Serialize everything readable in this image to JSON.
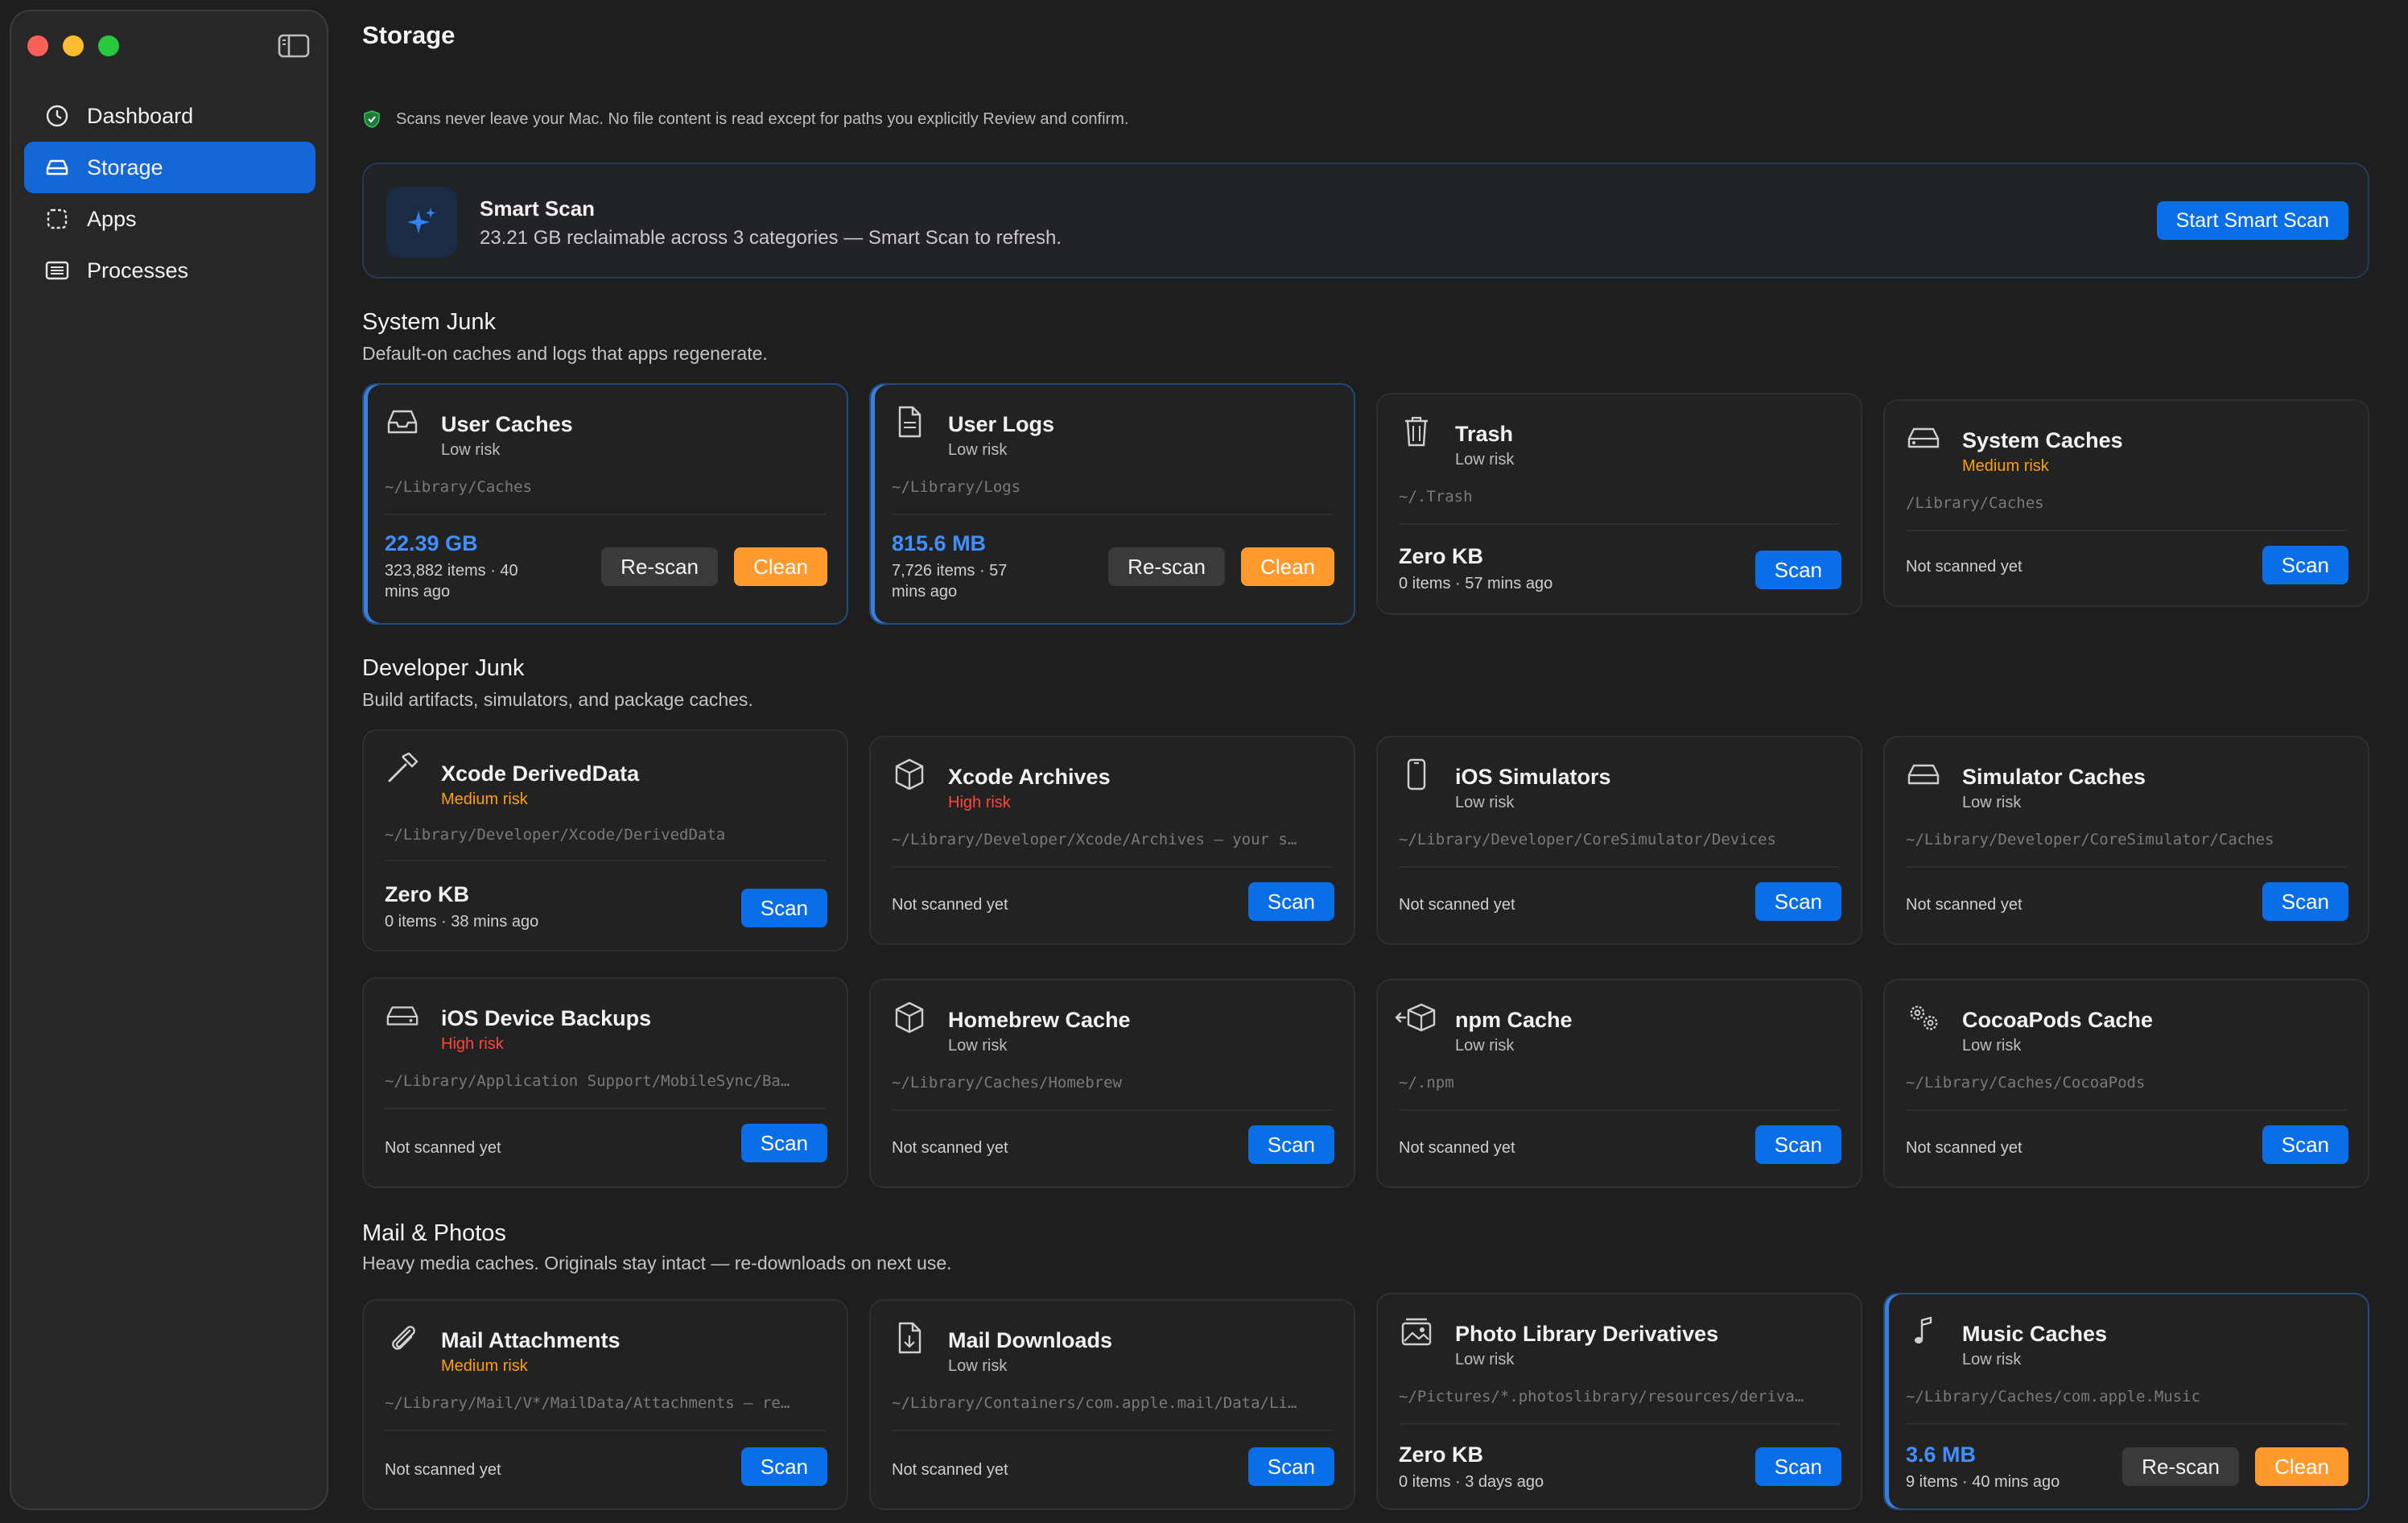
{
  "sidebar": {
    "items": [
      {
        "label": "Dashboard",
        "icon": "gauge-icon"
      },
      {
        "label": "Storage",
        "icon": "drive-icon",
        "active": true
      },
      {
        "label": "Apps",
        "icon": "app-square-icon"
      },
      {
        "label": "Processes",
        "icon": "list-window-icon"
      }
    ]
  },
  "page": {
    "title": "Storage",
    "privacy_note": "Scans never leave your Mac. No file content is read except for paths you explicitly Review and confirm."
  },
  "smart_scan": {
    "title": "Smart Scan",
    "subtitle": "23.21 GB reclaimable across 3 categories — Smart Scan to refresh.",
    "button": "Start Smart Scan"
  },
  "buttons": {
    "scan": "Scan",
    "rescan": "Re-scan",
    "clean": "Clean"
  },
  "sections": {
    "system": {
      "title": "System Junk",
      "subtitle": "Default-on caches and logs that apps regenerate.",
      "cards": [
        {
          "title": "User Caches",
          "risk": "Low risk",
          "path": "~/Library/Caches",
          "size": "22.39 GB",
          "meta": "323,882 items · 40 mins ago"
        },
        {
          "title": "User Logs",
          "risk": "Low risk",
          "path": "~/Library/Logs",
          "size": "815.6 MB",
          "meta": "7,726 items · 57 mins ago"
        },
        {
          "title": "Trash",
          "risk": "Low risk",
          "path": "~/.Trash",
          "size": "Zero KB",
          "meta": "0 items · 57 mins ago"
        },
        {
          "title": "System Caches",
          "risk": "Medium risk",
          "path": "/Library/Caches",
          "status": "Not scanned yet"
        }
      ]
    },
    "developer": {
      "title": "Developer Junk",
      "subtitle": "Build artifacts, simulators, and package caches.",
      "cards": [
        {
          "title": "Xcode DerivedData",
          "risk": "Medium risk",
          "path": "~/Library/Developer/Xcode/DerivedData",
          "size": "Zero KB",
          "meta": "0 items · 38 mins ago"
        },
        {
          "title": "Xcode Archives",
          "risk": "High risk",
          "path": "~/Library/Developer/Xcode/Archives — your s…",
          "status": "Not scanned yet"
        },
        {
          "title": "iOS Simulators",
          "risk": "Low risk",
          "path": "~/Library/Developer/CoreSimulator/Devices",
          "status": "Not scanned yet"
        },
        {
          "title": "Simulator Caches",
          "risk": "Low risk",
          "path": "~/Library/Developer/CoreSimulator/Caches",
          "status": "Not scanned yet"
        },
        {
          "title": "iOS Device Backups",
          "risk": "High risk",
          "path": "~/Library/Application Support/MobileSync/Ba…",
          "status": "Not scanned yet"
        },
        {
          "title": "Homebrew Cache",
          "risk": "Low risk",
          "path": "~/Library/Caches/Homebrew",
          "status": "Not scanned yet"
        },
        {
          "title": "npm Cache",
          "risk": "Low risk",
          "path": "~/.npm",
          "status": "Not scanned yet"
        },
        {
          "title": "CocoaPods Cache",
          "risk": "Low risk",
          "path": "~/Library/Caches/CocoaPods",
          "status": "Not scanned yet"
        }
      ]
    },
    "mail": {
      "title": "Mail & Photos",
      "subtitle": "Heavy media caches. Originals stay intact — re-downloads on next use.",
      "cards": [
        {
          "title": "Mail Attachments",
          "risk": "Medium risk",
          "path": "~/Library/Mail/V*/MailData/Attachments — re…",
          "status": "Not scanned yet"
        },
        {
          "title": "Mail Downloads",
          "risk": "Low risk",
          "path": "~/Library/Containers/com.apple.mail/Data/Li…",
          "status": "Not scanned yet"
        },
        {
          "title": "Photo Library Derivatives",
          "risk": "Low risk",
          "path": "~/Pictures/*.photoslibrary/resources/deriva…",
          "size": "Zero KB",
          "meta": "0 items · 3 days ago"
        },
        {
          "title": "Music Caches",
          "risk": "Low risk",
          "path": "~/Library/Caches/com.apple.Music",
          "size": "3.6 MB",
          "meta": "9 items · 40 mins ago"
        }
      ]
    }
  },
  "colors": {
    "accent": "#0a6ee8",
    "clean": "#ff9a2e",
    "medium_risk": "#ff9f0a",
    "high_risk": "#ff453a",
    "selected_nav": "#1567d8"
  }
}
